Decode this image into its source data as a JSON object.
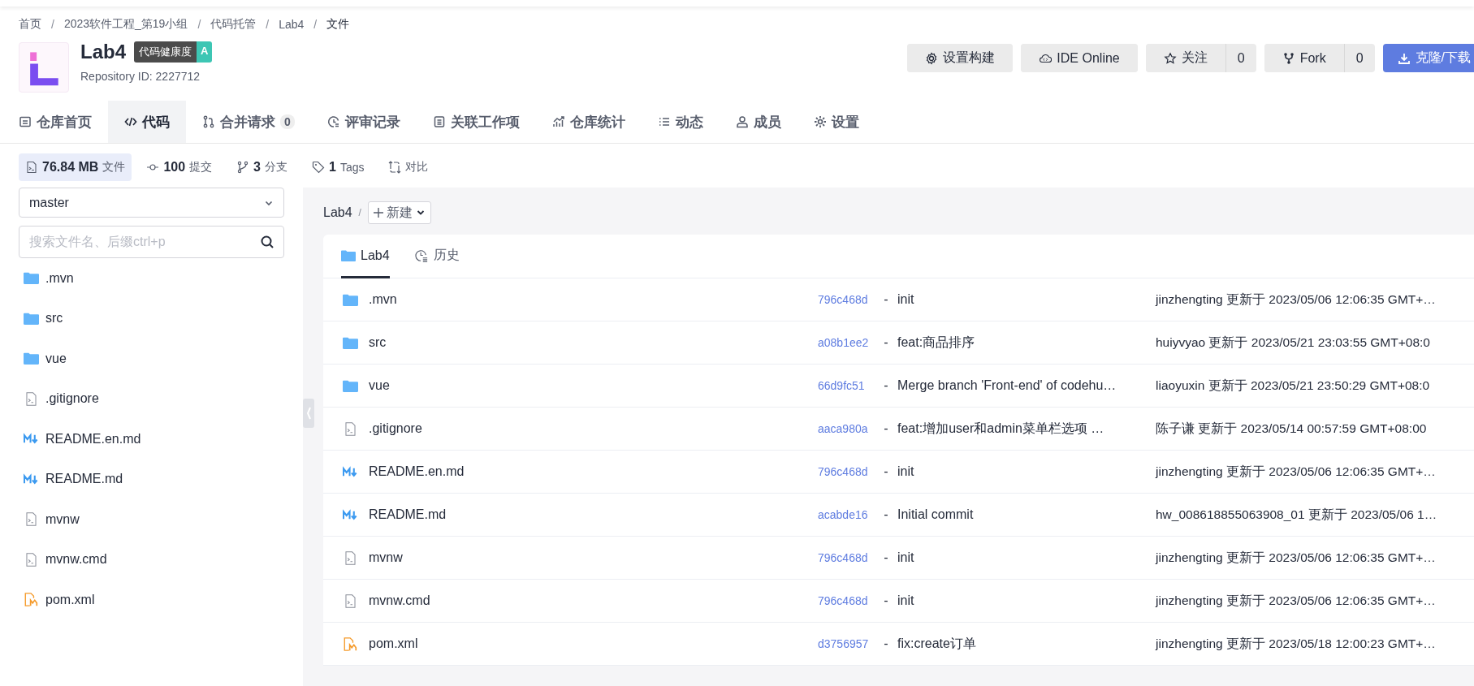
{
  "breadcrumb": [
    {
      "label": "首页",
      "separator": "/"
    },
    {
      "label": "2023软件工程_第19小组",
      "separator": "/"
    },
    {
      "label": "代码托管",
      "separator": "/"
    },
    {
      "label": "Lab4",
      "separator": "/"
    },
    {
      "label": "文件"
    }
  ],
  "repo": {
    "name": "Lab4",
    "badge_label": "代码健康度",
    "badge_grade": "A",
    "repository_id": "Repository ID: 2227712"
  },
  "actions": [
    {
      "label": "设置构建",
      "kind": "settings"
    },
    {
      "label": "IDE Online",
      "kind": "ide"
    },
    {
      "label": "关注",
      "kind": "star",
      "count": "0"
    },
    {
      "label": "Fork",
      "kind": "fork",
      "count": "0"
    },
    {
      "label": "克隆/下载",
      "kind": "clone"
    }
  ],
  "tabs": [
    {
      "label": "仓库首页",
      "selected": false
    },
    {
      "label": "代码",
      "selected": true
    },
    {
      "label": "合并请求",
      "count": "0",
      "selected": false
    },
    {
      "label": "评审记录",
      "selected": false
    },
    {
      "label": "关联工作项",
      "selected": false
    },
    {
      "label": "仓库统计",
      "selected": false
    },
    {
      "label": "动态",
      "selected": false
    },
    {
      "label": "成员",
      "selected": false
    },
    {
      "label": "设置",
      "selected": false
    }
  ],
  "stats": [
    {
      "value": "76.84 MB",
      "label": "文件",
      "selected": true
    },
    {
      "value": "100",
      "label": "提交",
      "selected": false
    },
    {
      "value": "3",
      "label": "分支",
      "selected": false
    },
    {
      "value": "1",
      "label": "Tags",
      "selected": false
    },
    {
      "label": "对比",
      "selected": false
    }
  ],
  "sidebar": {
    "branch": "master",
    "search_placeholder": "搜索文件名、后缀ctrl+p",
    "files": [
      {
        "name": ".mvn",
        "kind": "folder"
      },
      {
        "name": "src",
        "kind": "folder"
      },
      {
        "name": "vue",
        "kind": "folder"
      },
      {
        "name": ".gitignore",
        "kind": "file"
      },
      {
        "name": "README.en.md",
        "kind": "markdown"
      },
      {
        "name": "README.md",
        "kind": "markdown"
      },
      {
        "name": "mvnw",
        "kind": "file"
      },
      {
        "name": "mvnw.cmd",
        "kind": "file"
      },
      {
        "name": "pom.xml",
        "kind": "xml"
      }
    ]
  },
  "path": {
    "root": "Lab4",
    "separator": "/",
    "new_button": "新建"
  },
  "card_tabs": [
    {
      "label": "Lab4",
      "selected": true
    },
    {
      "label": "历史",
      "selected": false
    }
  ],
  "rows": [
    {
      "name": ".mvn",
      "kind": "folder",
      "commit": "796c468d",
      "separator": "-",
      "message": "init",
      "updated": "jinzhengting 更新于 2023/05/06 12:06:35 GMT+…"
    },
    {
      "name": "src",
      "kind": "folder",
      "commit": "a08b1ee2",
      "separator": "-",
      "message": "feat:商品排序",
      "updated": "huiyvyao 更新于 2023/05/21 23:03:55 GMT+08:0"
    },
    {
      "name": "vue",
      "kind": "folder",
      "commit": "66d9fc51",
      "separator": "-",
      "message": "Merge branch 'Front-end' of codehu…",
      "updated": "liaoyuxin 更新于 2023/05/21 23:50:29 GMT+08:0"
    },
    {
      "name": ".gitignore",
      "kind": "file",
      "commit": "aaca980a",
      "separator": "-",
      "message": "feat:增加user和admin菜单栏选项 …",
      "updated": "陈子谦 更新于 2023/05/14 00:57:59 GMT+08:00"
    },
    {
      "name": "README.en.md",
      "kind": "markdown",
      "commit": "796c468d",
      "separator": "-",
      "message": "init",
      "updated": "jinzhengting 更新于 2023/05/06 12:06:35 GMT+…"
    },
    {
      "name": "README.md",
      "kind": "markdown",
      "commit": "acabde16",
      "separator": "-",
      "message": "Initial commit",
      "updated": "hw_008618855063908_01 更新于 2023/05/06 1…"
    },
    {
      "name": "mvnw",
      "kind": "file",
      "commit": "796c468d",
      "separator": "-",
      "message": "init",
      "updated": "jinzhengting 更新于 2023/05/06 12:06:35 GMT+…"
    },
    {
      "name": "mvnw.cmd",
      "kind": "file",
      "commit": "796c468d",
      "separator": "-",
      "message": "init",
      "updated": "jinzhengting 更新于 2023/05/06 12:06:35 GMT+…"
    },
    {
      "name": "pom.xml",
      "kind": "xml",
      "commit": "d3756957",
      "separator": "-",
      "message": "fix:create订单",
      "updated": "jinzhengting 更新于 2023/05/18 12:00:23 GMT+…"
    }
  ]
}
